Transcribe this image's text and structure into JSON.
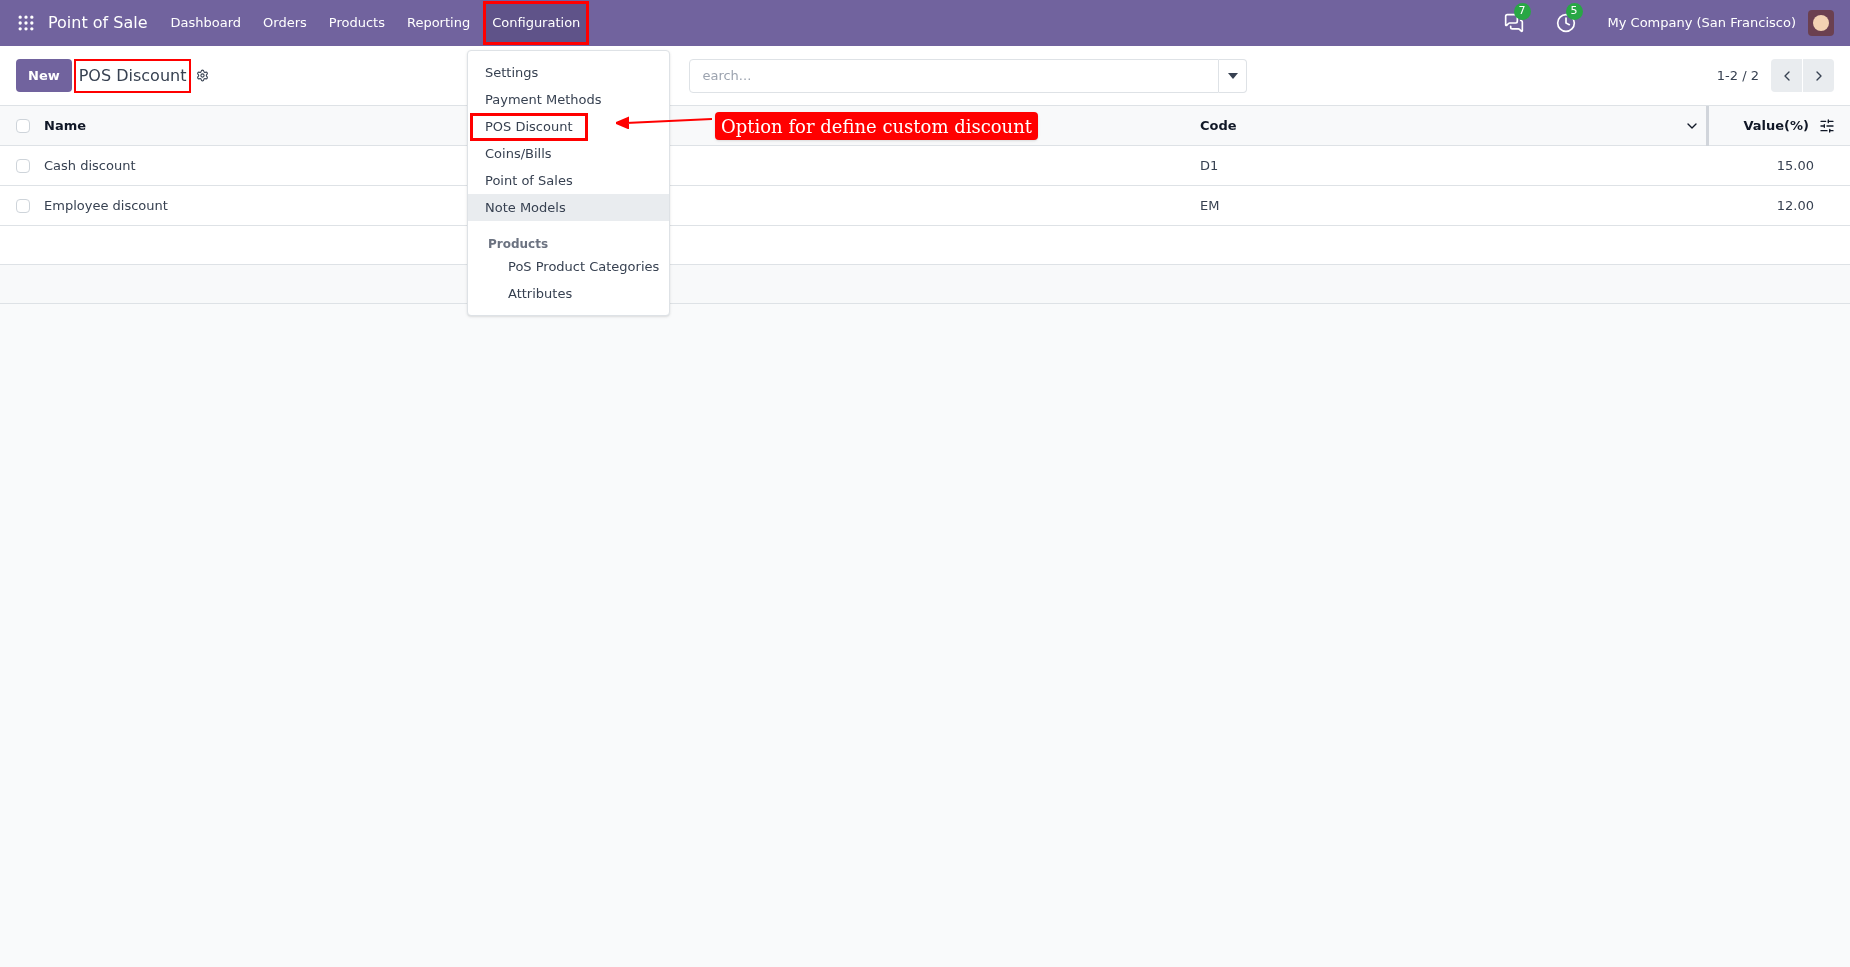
{
  "navbar": {
    "app_name": "Point of Sale",
    "menus": [
      {
        "label": "Dashboard",
        "selected": false,
        "highlighted": false
      },
      {
        "label": "Orders",
        "selected": false,
        "highlighted": false
      },
      {
        "label": "Products",
        "selected": false,
        "highlighted": false
      },
      {
        "label": "Reporting",
        "selected": false,
        "highlighted": false
      },
      {
        "label": "Configuration",
        "selected": true,
        "highlighted": true
      }
    ],
    "messages_badge": "7",
    "activities_badge": "5",
    "company": "My Company (San Francisco)"
  },
  "control_panel": {
    "new_button": "New",
    "title": "POS Discount",
    "title_highlighted": true,
    "search": {
      "placeholder": "earch..."
    },
    "pager": "1-2 / 2"
  },
  "table": {
    "select_all_checked": false,
    "columns": [
      "Name",
      "Code",
      "Value(%)"
    ],
    "rows": [
      {
        "name": "Cash discount",
        "code": "D1",
        "value": "15.00",
        "checked": false
      },
      {
        "name": "Employee discount",
        "code": "EM",
        "value": "12.00",
        "checked": false
      }
    ]
  },
  "dropdown": {
    "items": [
      {
        "kind": "item",
        "label": "Settings"
      },
      {
        "kind": "item",
        "label": "Payment Methods"
      },
      {
        "kind": "item",
        "label": "POS Discount",
        "highlighted": true
      },
      {
        "kind": "item",
        "label": "Coins/Bills"
      },
      {
        "kind": "item",
        "label": "Point of Sales"
      },
      {
        "kind": "item",
        "label": "Note Models",
        "hovered": true
      },
      {
        "kind": "header",
        "label": "Products"
      },
      {
        "kind": "subitem",
        "label": "PoS Product Categories"
      },
      {
        "kind": "subitem",
        "label": "Attributes"
      }
    ]
  },
  "annotation": {
    "text": "Option for define custom discount"
  }
}
